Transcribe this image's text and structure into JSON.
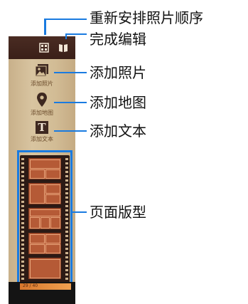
{
  "callouts": {
    "rearrange": "重新安排照片顺序",
    "done": "完成编辑",
    "add_photo": "添加照片",
    "add_map": "添加地图",
    "add_text": "添加文本",
    "layouts": "页面版型"
  },
  "tools": {
    "add_photo_label": "添加照片",
    "add_map_label": "添加地图",
    "add_text_label": "添加文本",
    "text_glyph": "T"
  },
  "bottom": {
    "caption": "29 / 40"
  },
  "colors": {
    "accent": "#1a7be0",
    "panel": "#d2bc95",
    "topbar": "#3a1f18",
    "frame": "#b55a36"
  }
}
